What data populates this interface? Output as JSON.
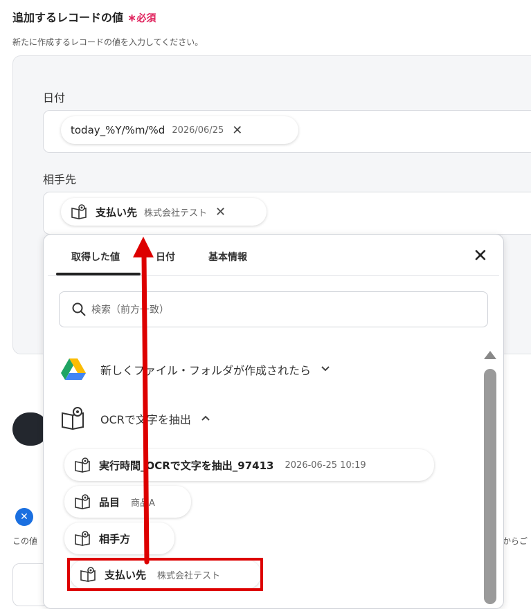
{
  "header": {
    "title": "追加するレコードの値",
    "required_star": "∗",
    "required_label": "必須",
    "subtitle": "新たに作成するレコードの値を入力してください。"
  },
  "fields": {
    "date": {
      "label": "日付",
      "chip_name": "today_%Y/%m/%d",
      "chip_value": "2026/06/25"
    },
    "partner": {
      "label": "相手先",
      "chip_name": "支払い先",
      "chip_value": "株式会社テスト"
    }
  },
  "dropdown": {
    "tabs": [
      "取得した値",
      "日付",
      "基本情報"
    ],
    "active_tab": 0,
    "search_placeholder": "検索（前方一致）",
    "sections": [
      {
        "title": "新しくファイル・フォルダが作成されたら",
        "expanded": false,
        "icon": "google-drive-icon"
      },
      {
        "title": "OCRで文字を抽出",
        "expanded": true,
        "icon": "ocr-book-icon"
      }
    ],
    "items": [
      {
        "name": "実行時間_OCRで文字を抽出_97413",
        "value": "2026-06-25 10:19"
      },
      {
        "name": "品目",
        "value": "商品A"
      },
      {
        "name": "相手方",
        "value": ""
      },
      {
        "name": "支払い先",
        "value": "株式会社テスト"
      }
    ],
    "chevron_down": "⌄",
    "chevron_up": "⌃",
    "close": "✕"
  },
  "background": {
    "snippet_start": "この値",
    "snippet_end": "からご"
  },
  "colors": {
    "required": "#e0245e",
    "annotation": "#dd0000",
    "dark_button": "#23272e"
  }
}
